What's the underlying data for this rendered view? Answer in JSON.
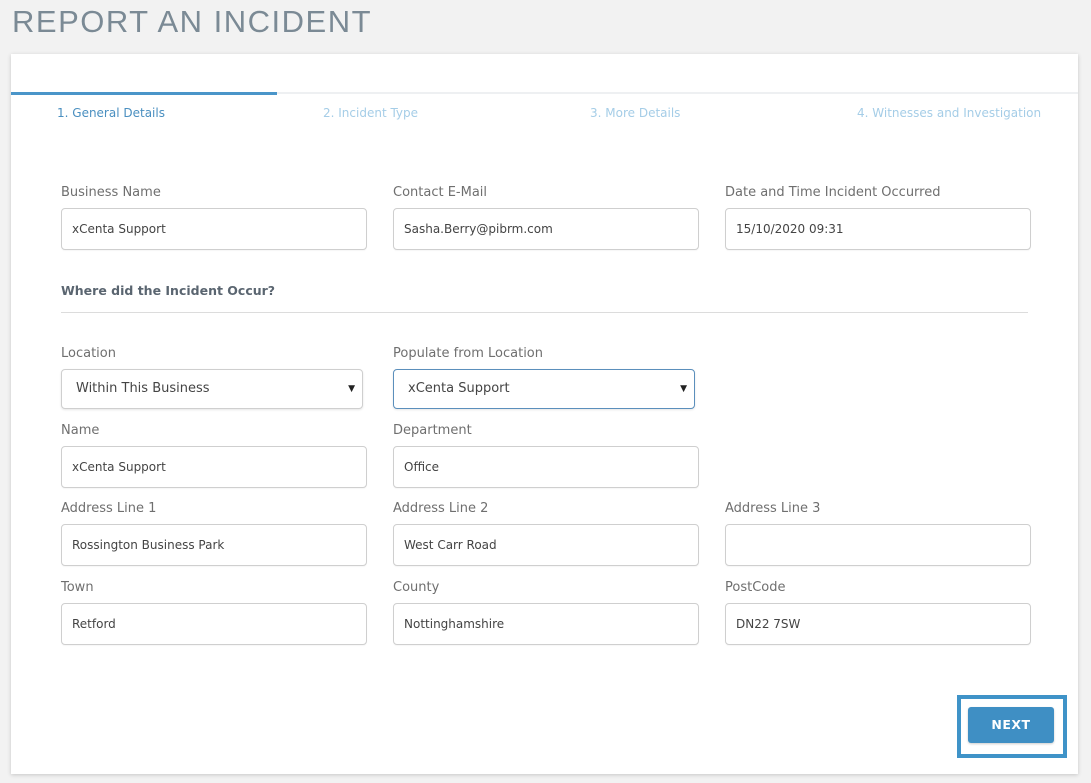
{
  "page": {
    "title": "REPORT AN INCIDENT"
  },
  "steps": [
    {
      "label": "1. General Details",
      "active": true
    },
    {
      "label": "2. Incident Type",
      "active": false
    },
    {
      "label": "3. More Details",
      "active": false
    },
    {
      "label": "4. Witnesses and Investigation",
      "active": false
    }
  ],
  "general": {
    "business_name": {
      "label": "Business Name",
      "value": "xCenta Support"
    },
    "contact_email": {
      "label": "Contact E-Mail",
      "value": "Sasha.Berry@pibrm.com"
    },
    "date_time": {
      "label": "Date and Time Incident Occurred",
      "value": "15/10/2020 09:31"
    }
  },
  "location_section": {
    "heading": "Where did the Incident Occur?",
    "location": {
      "label": "Location",
      "selected": "Within This Business"
    },
    "populate_from": {
      "label": "Populate from Location",
      "selected": "xCenta Support"
    },
    "name": {
      "label": "Name",
      "value": "xCenta Support"
    },
    "department": {
      "label": "Department",
      "value": "Office"
    },
    "address_line_1": {
      "label": "Address Line 1",
      "value": "Rossington Business Park"
    },
    "address_line_2": {
      "label": "Address Line 2",
      "value": "West Carr Road"
    },
    "address_line_3": {
      "label": "Address Line 3",
      "value": ""
    },
    "town": {
      "label": "Town",
      "value": "Retford"
    },
    "county": {
      "label": "County",
      "value": "Nottinghamshire"
    },
    "postcode": {
      "label": "PostCode",
      "value": "DN22 7SW"
    }
  },
  "actions": {
    "next_label": "NEXT"
  },
  "icons": {
    "dropdown": "dropdown-arrow-icon"
  },
  "colors": {
    "accent": "#3f8fc4",
    "step_active": "#4a8fc0",
    "step_inactive": "#a5cde7",
    "title": "#7b8a95"
  }
}
